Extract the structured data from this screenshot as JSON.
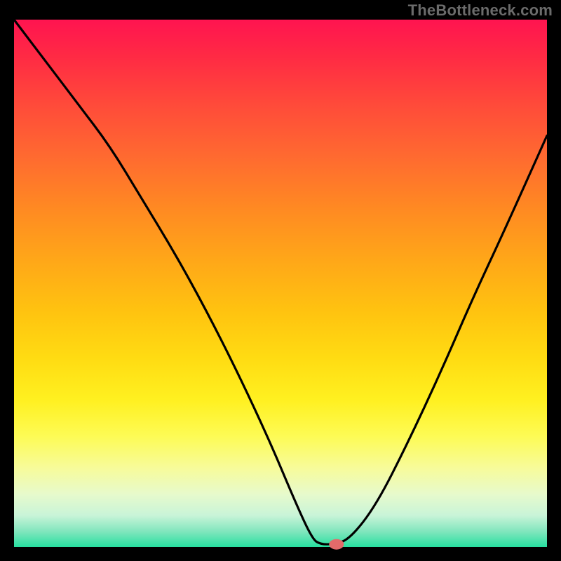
{
  "watermark": "TheBottleneck.com",
  "colors": {
    "curve": "#000000",
    "marker": "#e46a6a",
    "frame": "#000000"
  },
  "chart_data": {
    "type": "line",
    "title": "",
    "xlabel": "",
    "ylabel": "",
    "xlim": [
      0,
      100
    ],
    "ylim": [
      0,
      100
    ],
    "grid": false,
    "legend": false,
    "x": [
      0,
      6,
      12,
      18,
      24,
      30,
      36,
      42,
      48,
      53,
      56,
      57.5,
      60,
      63,
      68,
      74,
      80,
      86,
      92,
      100
    ],
    "values": [
      100,
      92,
      84,
      76,
      66,
      56,
      45,
      33,
      20,
      8,
      1.5,
      0.5,
      0.5,
      1.5,
      8,
      20,
      33,
      47,
      60,
      78
    ],
    "annotations": [
      {
        "type": "marker",
        "x": 60.5,
        "y": 0.5,
        "label": ""
      }
    ]
  }
}
